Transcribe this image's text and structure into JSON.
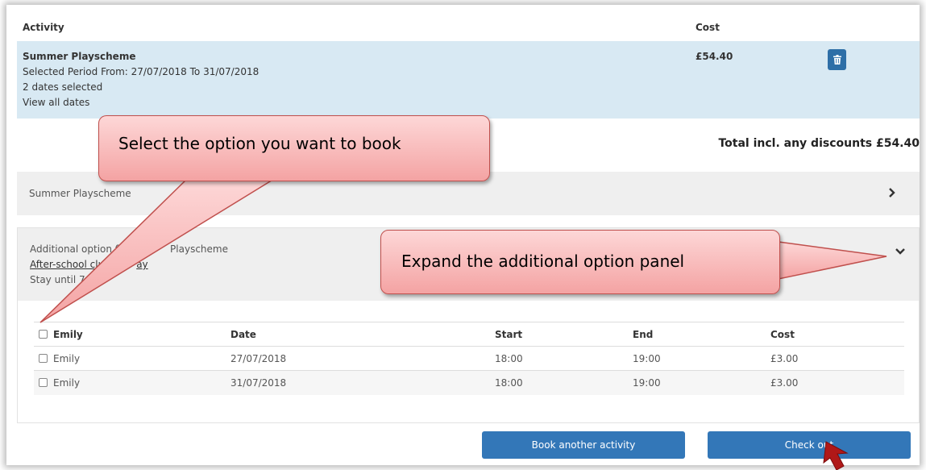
{
  "basket": {
    "headers": {
      "activity": "Activity",
      "cost": "Cost"
    },
    "item": {
      "title": "Summer Playscheme",
      "period": "Selected Period From: 27/07/2018 To 31/07/2018",
      "dates_selected": "2 dates selected",
      "view_dates": "View all dates",
      "cost": "£54.40"
    },
    "total": "Total incl. any discounts £54.40"
  },
  "panel": {
    "label": "Summer Playscheme"
  },
  "option": {
    "line1": "Additional option f",
    "line1_tail": "Playscheme",
    "line2": "After-school clu",
    "line2_tail": "ay",
    "line3": "Stay until 7p"
  },
  "table": {
    "headers": [
      "Emily",
      "Date",
      "Start",
      "End",
      "Cost"
    ],
    "rows": [
      [
        "Emily",
        "27/07/2018",
        "18:00",
        "19:00",
        "£3.00"
      ],
      [
        "Emily",
        "31/07/2018",
        "18:00",
        "19:00",
        "£3.00"
      ]
    ]
  },
  "buttons": {
    "book_another": "Book another activity",
    "check_out": "Check out"
  },
  "callouts": {
    "select_option": "Select the option you want to book",
    "expand_panel": "Expand the additional option panel"
  },
  "colors": {
    "primary": "#3377b8",
    "basket_bg": "#d8e9f3",
    "callout_border": "#c0504d",
    "arrow": "#b01818"
  },
  "icons": {
    "delete": "trash-icon",
    "expand": "chevron-right-icon",
    "collapse": "chevron-down-icon"
  }
}
